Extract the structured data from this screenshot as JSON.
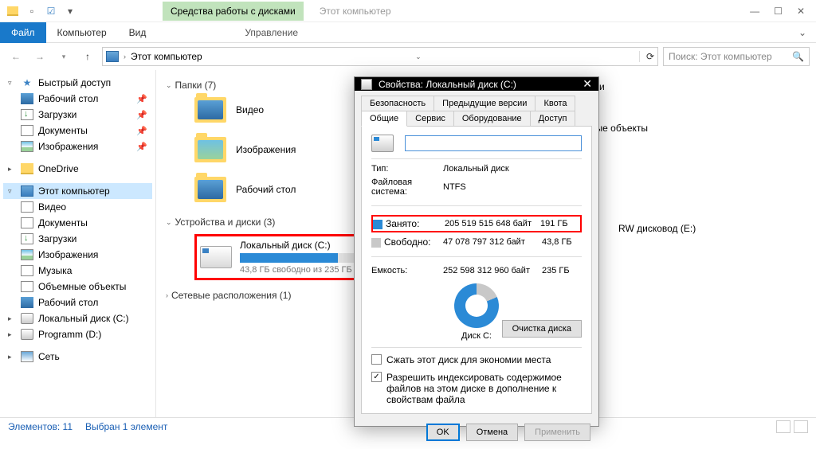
{
  "window": {
    "title": "Этот компьютер",
    "ribbon_highlight": "Средства работы с дисками"
  },
  "ribbon": {
    "tabs": [
      "Файл",
      "Компьютер",
      "Вид"
    ],
    "subtab": "Управление"
  },
  "address": {
    "path": "Этот компьютер",
    "search_placeholder": "Поиск: Этот компьютер"
  },
  "nav": {
    "quick_access": "Быстрый доступ",
    "qa_items": [
      "Рабочий стол",
      "Загрузки",
      "Документы",
      "Изображения"
    ],
    "onedrive": "OneDrive",
    "this_pc": "Этот компьютер",
    "pc_items": [
      "Видео",
      "Документы",
      "Загрузки",
      "Изображения",
      "Музыка",
      "Объемные объекты",
      "Рабочий стол",
      "Локальный диск (C:)",
      "Programm (D:)"
    ],
    "network": "Сеть"
  },
  "content": {
    "folders_header": "Папки (7)",
    "devices_header": "Устройства и диски (3)",
    "netloc_header": "Сетевые расположения (1)",
    "folders": [
      "Видео",
      "Изображения",
      "Рабочий стол"
    ],
    "extra_right_1": "ружки",
    "extra_right_2": "емные объекты",
    "extra_right_3": "RW дисковод (E:)",
    "drive": {
      "name": "Локальный диск (C:)",
      "sub": "43,8 ГБ свободно из 235 ГБ"
    }
  },
  "status": {
    "left": "Элементов: 11",
    "sel": "Выбран 1 элемент"
  },
  "dialog": {
    "title": "Свойства: Локальный диск (C:)",
    "tabs_row1": [
      "Безопасность",
      "Предыдущие версии",
      "Квота"
    ],
    "tabs_row2": [
      "Общие",
      "Сервис",
      "Оборудование",
      "Доступ"
    ],
    "type_label": "Тип:",
    "type_val": "Локальный диск",
    "fs_label": "Файловая система:",
    "fs_val": "NTFS",
    "used_label": "Занято:",
    "used_bytes": "205 519 515 648 байт",
    "used_gb": "191 ГБ",
    "free_label": "Свободно:",
    "free_bytes": "47 078 797 312 байт",
    "free_gb": "43,8 ГБ",
    "cap_label": "Емкость:",
    "cap_bytes": "252 598 312 960 байт",
    "cap_gb": "235 ГБ",
    "disk_label": "Диск C:",
    "cleanup": "Очистка диска",
    "chk1": "Сжать этот диск для экономии места",
    "chk2": "Разрешить индексировать содержимое файлов на этом диске в дополнение к свойствам файла",
    "ok": "OK",
    "cancel": "Отмена",
    "apply": "Применить"
  }
}
